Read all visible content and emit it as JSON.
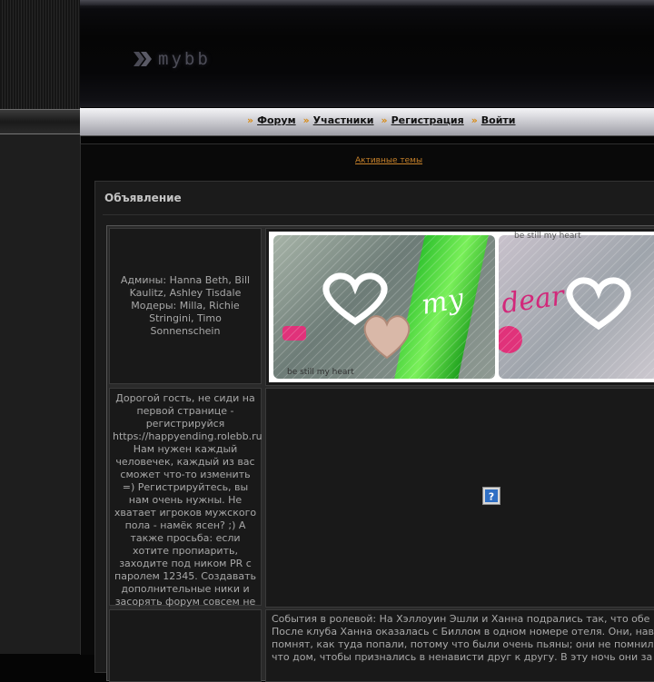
{
  "header": {
    "logo_text": "mybb"
  },
  "nav": {
    "items": [
      {
        "label": "Форум"
      },
      {
        "label": "Участники"
      },
      {
        "label": "Регистрация"
      },
      {
        "label": "Войти"
      }
    ],
    "arrow": "»"
  },
  "main": {
    "active_topics_link": "Активные темы",
    "announcement": {
      "title": "Объявление",
      "rows": [
        {
          "left": "Админы: Hanna Beth, Bill Kaulitz, Ashley Tisdale Модеры: Milla, Richie Stringini, Timo Sonnenschein"
        },
        {
          "left": "Дорогой гость, не сиди на первой странице - регистрируйся https://happyending.rolebb.ru Нам нужен каждый человечек, каждый из вас сможет что-то изменить =) Регистрируйтесь, вы нам очень нужны. Не хватает игроков мужского пола - намёк ясен? ;) А также просьба: если хотите пропиарить, заходите под ником PR с паролем 12345. Создавать дополнительные ники и засорять форум совсем не обязательно."
        },
        {
          "left": "",
          "right_lines": [
            "События в ролевой: На Хэллоуин Эшли и Ханна подрались так, что обе п",
            " После клуба Ханна оказалась с Биллом в одном номере отеля. Они, нав",
            " помнят, как туда попали, потому что были очень пьяны; они не помнил",
            " что дом, чтобы признались в ненависти друг к другу. В эту ночь они за"
          ]
        }
      ],
      "banner": {
        "text_my": "my",
        "text_dear": "dear",
        "caption_left": "be still my heart",
        "caption_right": "be still my heart"
      }
    }
  },
  "colors": {
    "accent_orange": "#d88b16",
    "link_orange": "#c8822a",
    "pink": "#d2287a",
    "green": "#2cc02c"
  },
  "icons": {
    "logo_chevron": "double-chevron-icon",
    "broken_image": "broken-image-icon"
  }
}
